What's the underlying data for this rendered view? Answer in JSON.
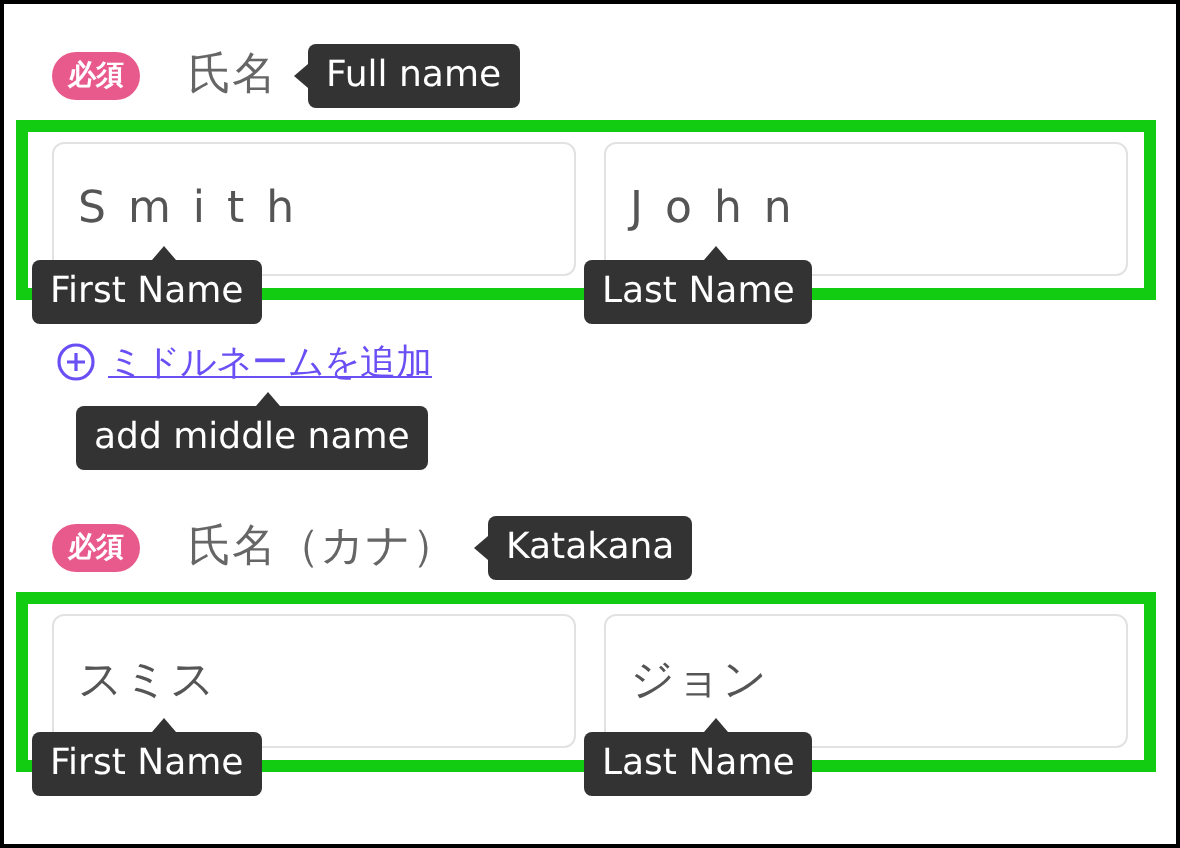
{
  "sections": [
    {
      "required_badge": "必須",
      "label": "氏名",
      "label_callout": "Full name",
      "highlighted": true,
      "letter_spaced": true,
      "fields": [
        {
          "value": "Smith",
          "callout": "First Name"
        },
        {
          "value": "John",
          "callout": "Last Name"
        }
      ],
      "link": {
        "text": "ミドルネームを追加",
        "callout": "add middle name"
      }
    },
    {
      "required_badge": "必須",
      "label": "氏名（カナ）",
      "label_callout": "Katakana",
      "highlighted": true,
      "letter_spaced": false,
      "fields": [
        {
          "value": "スミス",
          "callout": "First Name"
        },
        {
          "value": "ジョン",
          "callout": "Last Name"
        }
      ]
    }
  ]
}
